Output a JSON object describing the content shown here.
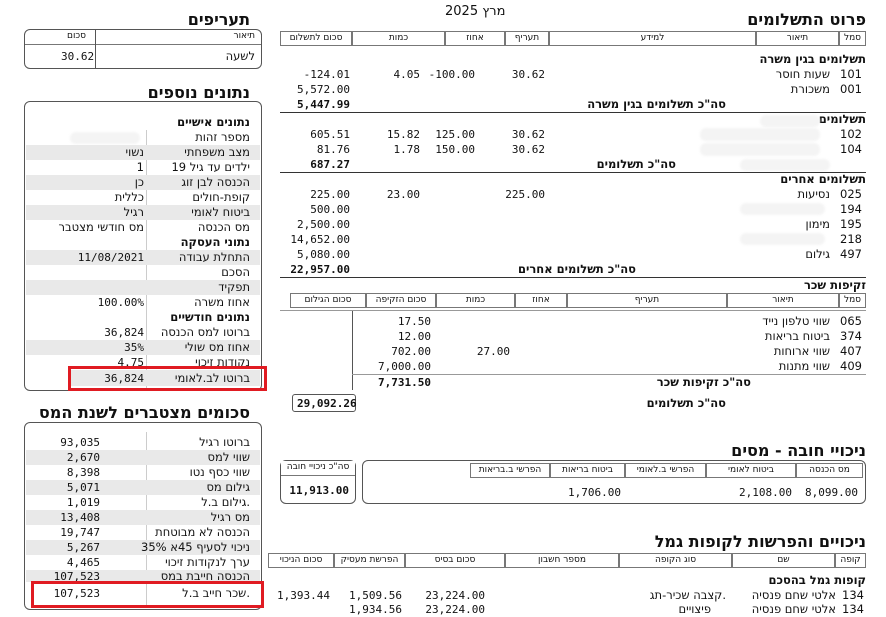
{
  "header": {
    "month_year": "מרץ 2025"
  },
  "payments": {
    "title": "פרוט התשלומים",
    "columns": [
      "סמל",
      "תיאור",
      "למידע",
      "תעריף",
      "אחוז",
      "כמות",
      "סכום לתשלום"
    ],
    "sec1_title": "תשלומים בגין משרה",
    "r101": {
      "code": "101",
      "desc": "שעות חוסר",
      "rate": "30.62",
      "pct": "-100.00",
      "qty": "4.05",
      "amount": "-124.01"
    },
    "r001": {
      "code": "001",
      "desc": "משכורת",
      "amount": "5,572.00"
    },
    "sec1_total": {
      "label": "סה\"כ תשלומים בגין משרה",
      "amount": "5,447.99"
    },
    "sec2_title": "תשלומים",
    "r102": {
      "code": "102",
      "rate": "30.62",
      "pct": "125.00",
      "qty": "15.82",
      "amount": "605.51"
    },
    "r104": {
      "code": "104",
      "rate": "30.62",
      "pct": "150.00",
      "qty": "1.78",
      "amount": "81.76"
    },
    "sec2_total": {
      "label": "סה\"כ תשלומים",
      "amount": "687.27"
    },
    "sec3_title": "תשלומים אחרים",
    "r025": {
      "code": "025",
      "desc": "נסיעות",
      "rate": "225.00",
      "qty": "23.00",
      "amount": "225.00"
    },
    "r194": {
      "code": "194",
      "amount": "500.00"
    },
    "r195": {
      "code": "195",
      "desc": "מימון",
      "amount": "2,500.00"
    },
    "r218": {
      "code": "218",
      "amount": "14,652.00"
    },
    "r497": {
      "code": "497",
      "desc": "גילום",
      "amount": "5,080.00"
    },
    "sec3_total": {
      "label": "סה\"כ תשלומים אחרים",
      "amount": "22,957.00"
    },
    "grand_label": "סה\"כ תשלומים",
    "grand_amount": "29,092.26"
  },
  "benefits": {
    "title": "זקיפות שכר",
    "columns": [
      "סמל",
      "תיאור",
      "תעריף",
      "אחוז",
      "כמות",
      "סכום הזקיפה",
      "סכום הגילום"
    ],
    "r065": {
      "code": "065",
      "desc": "שווי טלפון נייד",
      "amount": "17.50"
    },
    "r374": {
      "code": "374",
      "desc": "ביטוח בריאות",
      "amount": "12.00"
    },
    "r407": {
      "code": "407",
      "desc": "שווי ארוחות",
      "qty": "27.00",
      "amount": "702.00"
    },
    "r409": {
      "code": "409",
      "desc": "שווי מתנות",
      "amount": "7,000.00"
    },
    "total": {
      "label": "סה\"כ זקיפות שכר",
      "amount": "7,731.50"
    }
  },
  "mandatory": {
    "title": "ניכויי חובה - מסים",
    "columns": [
      "מס הכנסה",
      "ביטוח לאומי",
      "הפרשי ב.לאומי",
      "ביטוח בריאות",
      "הפרשי ב.בריאות"
    ],
    "values": [
      "8,099.00",
      "2,108.00",
      "",
      "1,706.00",
      ""
    ],
    "total_header": "סה\"כ ניכויי חובה",
    "total_value": "11,913.00"
  },
  "pension": {
    "title": "ניכויים והפרשות לקופות גמל",
    "columns": [
      "קופה",
      "שם",
      "סוג הקופה",
      "מספר חשבון",
      "סכום בסיס",
      "הפרשת מעסיק",
      "סכום הניכוי"
    ],
    "group_title": "קופות גמל בהסכם",
    "r1": {
      "code": "134",
      "name": "אלטי שחם פנסיה",
      "type": "קצבה שכיר-תג.",
      "base": "23,224.00",
      "employer": "1,509.56",
      "deduction": "1,393.44"
    },
    "r2": {
      "code": "134",
      "name": "אלטי שחם פנסיה",
      "type": "פיצויים",
      "base": "23,224.00",
      "employer": "1,934.56"
    }
  },
  "rates": {
    "title": "תעריפים",
    "col_desc": "תיאור",
    "col_amount": "סכום",
    "row_label": "לשעה",
    "row_value": "30.62"
  },
  "extra": {
    "title": "נתונים נוספים",
    "personal_title": "נתונים אישיים",
    "id_label": "מספר זהות",
    "marital_label": "מצב משפחתי",
    "marital_value": "נשוי",
    "kids_label": "ילדים עד גיל 19",
    "kids_value": "1",
    "spouse_income_label": "הכנסה לבן זוג",
    "spouse_income_value": "כן",
    "health_fund_label": "קופת-חולים",
    "health_fund_value": "כללית",
    "ni_label": "ביטוח לאומי",
    "ni_value": "רגיל",
    "tax_label": "מס הכנסה",
    "tax_value": "מס חודשי מצטבר",
    "employment_title": "נתוני העסקה",
    "start_label": "התחלת עבודה",
    "start_value": "11/08/2021",
    "agreement_label": "הסכם",
    "role_label": "תפקיד",
    "job_pct_label": "אחוז משרה",
    "job_pct_value": "100.00%",
    "monthly_title": "נתונים חודשיים",
    "gross_tax_label": "ברוטו למס הכנסה",
    "gross_tax_value": "36,824",
    "marginal_label": "אחוז מס שולי",
    "marginal_value": "35%",
    "credit_label": "נקודות זיכוי",
    "credit_value": "4.75",
    "gross_ni_label": "ברוטו לב.לאומי",
    "gross_ni_value": "36,824"
  },
  "annual": {
    "title": "סכומים מצטברים לשנת המס",
    "rows": [
      {
        "label": "ברוטו רגיל",
        "value": "93,035"
      },
      {
        "label": "שווי למס",
        "value": "2,670"
      },
      {
        "label": "שווי כסף נטו",
        "value": "8,398"
      },
      {
        "label": "גילום מס",
        "value": "5,071"
      },
      {
        "label": "גילום ב.ל.",
        "value": "1,019"
      },
      {
        "label": "מס רגיל",
        "value": "13,408"
      },
      {
        "label": "הכנסה לא מבוטחת",
        "value": "19,747"
      },
      {
        "label": "ניכוי לסעיף 45א 35%",
        "value": "5,267"
      },
      {
        "label": "ערך לנקודות זיכוי",
        "value": "4,465"
      },
      {
        "label": "הכנסה חייבת במס",
        "value": "107,523"
      },
      {
        "label": "שכר חייב ב.ל.",
        "value": "107,523"
      }
    ]
  },
  "colors": {
    "highlight_red": "#e01b22",
    "shade": "#e9e9e9"
  }
}
